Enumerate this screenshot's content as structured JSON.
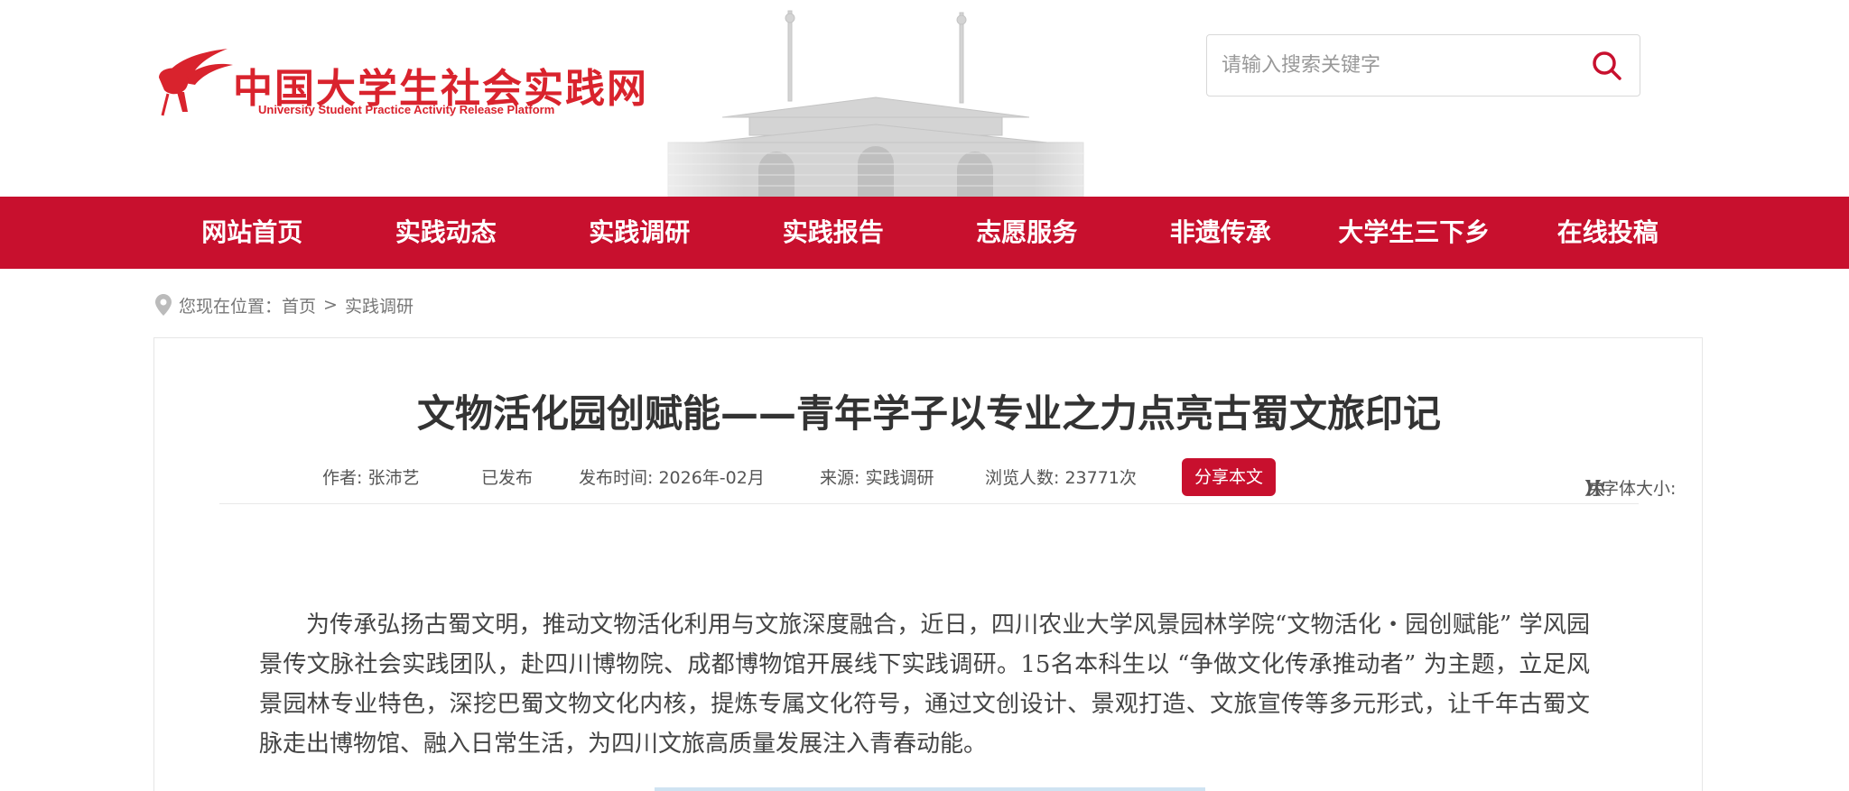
{
  "logo": {
    "name_cn": "中国大学生社会实践网",
    "name_en": "University Student Practice Activity Release Platform"
  },
  "colors": {
    "brand_red": "#c8102e",
    "logo_red": "#d9232d"
  },
  "search": {
    "placeholder": "请输入搜索关键字",
    "icon": "search-icon"
  },
  "nav": {
    "items": [
      {
        "label": "网站首页"
      },
      {
        "label": "实践动态"
      },
      {
        "label": "实践调研"
      },
      {
        "label": "实践报告"
      },
      {
        "label": "志愿服务"
      },
      {
        "label": "非遗传承"
      },
      {
        "label": "大学生三下乡"
      },
      {
        "label": "在线投稿"
      }
    ]
  },
  "breadcrumb": {
    "prefix": "您现在位置：",
    "home": "首页",
    "separator": ">",
    "current": "实践调研"
  },
  "article": {
    "title": "文物活化园创赋能——青年学子以专业之力点亮古蜀文旅印记",
    "meta": {
      "author": "作者:  张沛艺",
      "status": "已发布",
      "publish_time": "发布时间:  2026年-02月",
      "source": "来源:  实践调研",
      "views": "浏览人数:  23771次",
      "share_label": "分享本文",
      "font_size_prefix": "【字体大小:",
      "font_large": "大",
      "font_medium": "中",
      "font_small": "小",
      "font_size_suffix": "】"
    },
    "paragraph": "为传承弘扬古蜀文明，推动文物活化利用与文旅深度融合，近日，四川农业大学风景园林学院“文物活化・园创赋能” 学风园景传文脉社会实践团队，赴四川博物院、成都博物馆开展线下实践调研。15名本科生以 “争做文化传承推动者” 为主题，立足风景园林专业特色，深挖巴蜀文物文化内核，提炼专属文化符号，通过文创设计、景观打造、文旅宣传等多元形式，让千年古蜀文脉走出博物馆、融入日常生活，为四川文旅高质量发展注入青春动能。"
  }
}
